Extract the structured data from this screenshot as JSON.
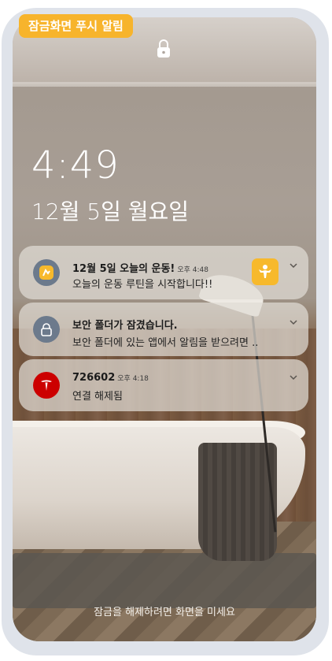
{
  "tag_label": "잠금화면 푸시 알림",
  "lock_screen": {
    "time": "4:49",
    "date": "12월 5일 월요일",
    "unlock_hint": "잠금을 해제하려면 화면을 미세요"
  },
  "notifications": [
    {
      "app_icon": "fitness-app-icon",
      "title": "12월 5일 오늘의 운동!",
      "time": "오후 4:48",
      "body": "오늘의 운동 루틴을 시작합니다!!",
      "has_thumbnail": true
    },
    {
      "app_icon": "lock-folder-icon",
      "title": "보안 폴더가 잠겼습니다.",
      "time": "",
      "body": "보안 폴더에 있는 앱에서 알림을 받으려면 ..",
      "has_thumbnail": false
    },
    {
      "app_icon": "tesla-icon",
      "title": "726602",
      "time": "오후 4:18",
      "body": "연결 해제됨",
      "has_thumbnail": false
    }
  ],
  "colors": {
    "accent": "#f7b42c",
    "frame": "#dfe3ea",
    "tesla_red": "#cc0000",
    "fitness_icon_bg": "#6c7a8c"
  }
}
